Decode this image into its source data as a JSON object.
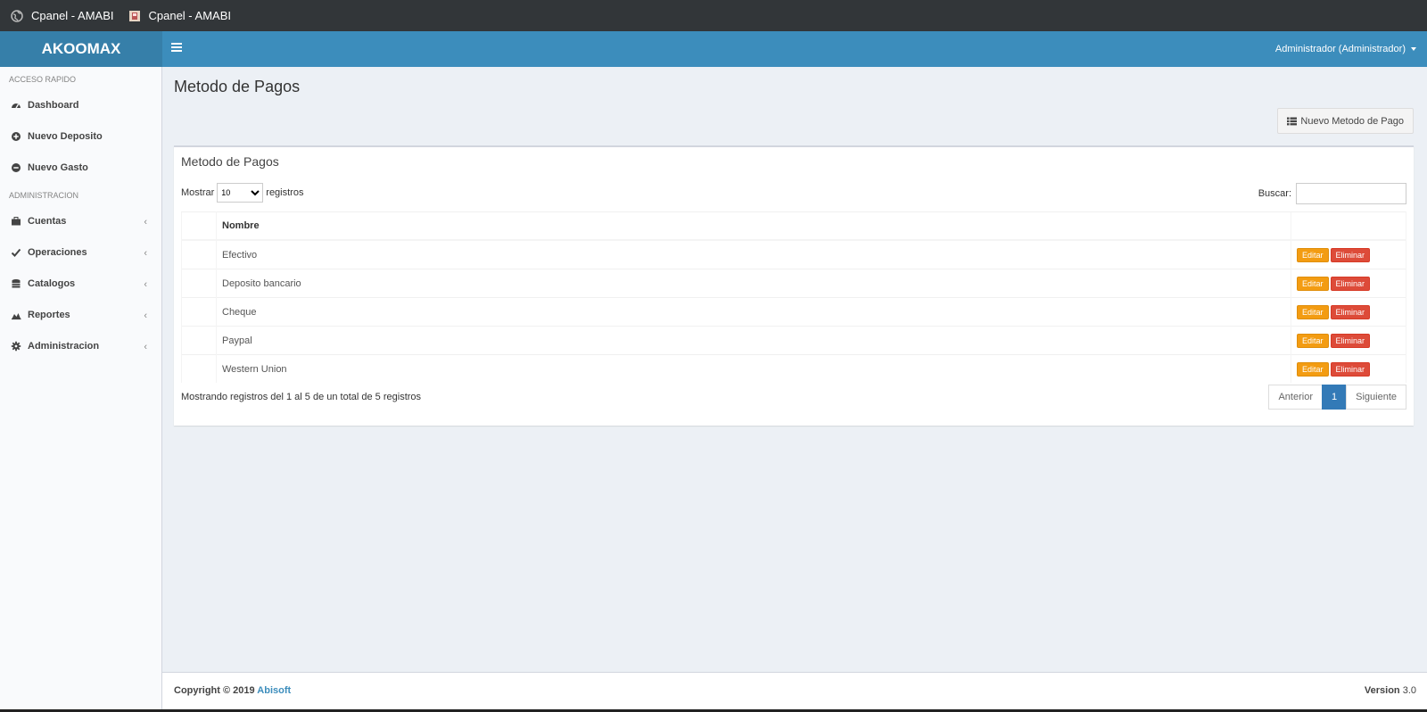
{
  "tabs": [
    {
      "title": "Cpanel - AMABI",
      "icon": "globe-icon"
    },
    {
      "title": "Cpanel - AMABI",
      "icon": "page-icon"
    }
  ],
  "header": {
    "logo": "AKOOMAX",
    "user": "Administrador (Administrador)"
  },
  "sidebar": {
    "section1": "ACCESO RAPIDO",
    "section2": "ADMINISTRACION",
    "items": [
      {
        "label": "Dashboard",
        "icon": "dashboard-icon"
      },
      {
        "label": "Nuevo Deposito",
        "icon": "plus-circle-icon"
      },
      {
        "label": "Nuevo Gasto",
        "icon": "minus-circle-icon"
      },
      {
        "label": "Cuentas",
        "icon": "briefcase-icon"
      },
      {
        "label": "Operaciones",
        "icon": "check-icon"
      },
      {
        "label": "Catalogos",
        "icon": "database-icon"
      },
      {
        "label": "Reportes",
        "icon": "area-chart-icon"
      },
      {
        "label": "Administracion",
        "icon": "gear-icon"
      }
    ]
  },
  "main": {
    "page_title": "Metodo de Pagos",
    "new_button": "Nuevo Metodo de Pago",
    "box_title": "Metodo de Pagos",
    "length_label_before": "Mostrar",
    "length_value": "10",
    "length_label_after": "registros",
    "search_label": "Buscar:",
    "search_value": "",
    "table": {
      "header": "Nombre",
      "rows": [
        "Efectivo",
        "Deposito bancario",
        "Cheque",
        "Paypal",
        "Western Union"
      ],
      "edit_label": "Editar",
      "delete_label": "Eliminar"
    },
    "info": "Mostrando registros del 1 al 5 de un total de 5 registros",
    "pager": {
      "prev": "Anterior",
      "current": "1",
      "next": "Siguiente"
    }
  },
  "footer": {
    "copyright": "Copyright © 2019",
    "company": "Abisoft",
    "version_label": "Version",
    "version": "3.0"
  },
  "colors": {
    "header": "#3c8dbc",
    "logo_bg": "#367fa9",
    "edit": "#f39c12",
    "delete": "#dd4b39",
    "pager_active": "#337ab7"
  }
}
